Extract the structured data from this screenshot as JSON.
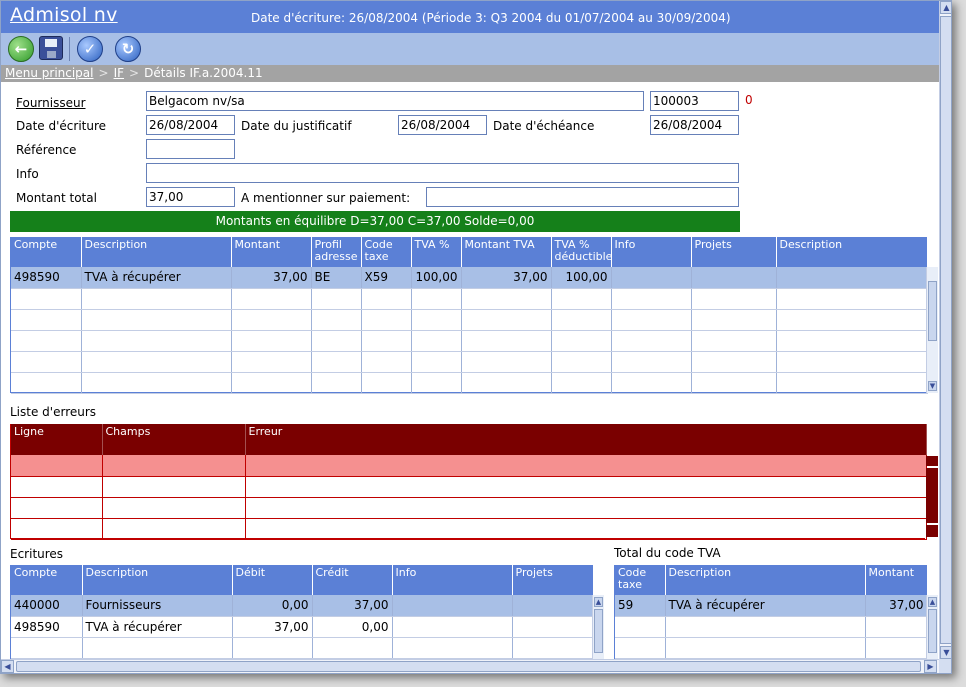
{
  "app": {
    "title": "Admisol nv",
    "date_info": "Date d'écriture: 26/08/2004 (Période 3: Q3 2004 du 01/07/2004 au 30/09/2004)"
  },
  "toolbar": {
    "icons": [
      "back-icon",
      "save-icon",
      "validate-icon",
      "refresh-icon"
    ]
  },
  "breadcrumb": {
    "home": "Menu principal",
    "section": "IF",
    "current": "Détails IF.a.2004.11",
    "separator": ">"
  },
  "form": {
    "fournisseur_label": "Fournisseur",
    "fournisseur_value": "Belgacom nv/sa",
    "fournisseur_code": "100003",
    "fournisseur_flag": "0",
    "date_ecriture_label": "Date d'écriture",
    "date_ecriture_value": "26/08/2004",
    "date_justificatif_label": "Date du justificatif",
    "date_justificatif_value": "26/08/2004",
    "date_echeance_label": "Date d'échéance",
    "date_echeance_value": "26/08/2004",
    "reference_label": "Référence",
    "reference_value": "",
    "info_label": "Info",
    "info_value": "",
    "montant_total_label": "Montant total",
    "montant_total_value": "37,00",
    "paiement_label": "A mentionner sur paiement:",
    "paiement_value": "",
    "balance_status": "Montants en équilibre D=37,00 C=37,00 Solde=0,00"
  },
  "lines_grid": {
    "headers": [
      "Compte",
      "Description",
      "Montant",
      "Profil adresse",
      "Code taxe",
      "TVA %",
      "Montant TVA",
      "TVA % déductible",
      "Info",
      "Projets",
      "Description"
    ],
    "rows": [
      [
        "498590",
        "TVA à récupérer",
        "37,00",
        "BE",
        "X59",
        "100,00",
        "37,00",
        "100,00",
        "",
        "",
        ""
      ]
    ]
  },
  "errors": {
    "title": "Liste d'erreurs",
    "headers": [
      "Ligne",
      "Champs",
      "Erreur"
    ]
  },
  "ecritures": {
    "title": "Ecritures",
    "headers": [
      "Compte",
      "Description",
      "Débit",
      "Crédit",
      "Info",
      "Projets"
    ],
    "rows": [
      [
        "440000",
        "Fournisseurs",
        "0,00",
        "37,00",
        "",
        ""
      ],
      [
        "498590",
        "TVA à récupérer",
        "37,00",
        "0,00",
        "",
        ""
      ]
    ]
  },
  "tva_totals": {
    "title": "Total du code TVA",
    "headers": [
      "Code taxe",
      "Description",
      "Montant"
    ],
    "rows": [
      [
        "59",
        "TVA à récupérer",
        "37,00"
      ]
    ]
  },
  "colors": {
    "header_blue": "#5b80d6",
    "toolbar_blue": "#a8bfe6",
    "balance_green": "#15801a",
    "error_red": "#7a0000",
    "error_row": "#f59090"
  }
}
